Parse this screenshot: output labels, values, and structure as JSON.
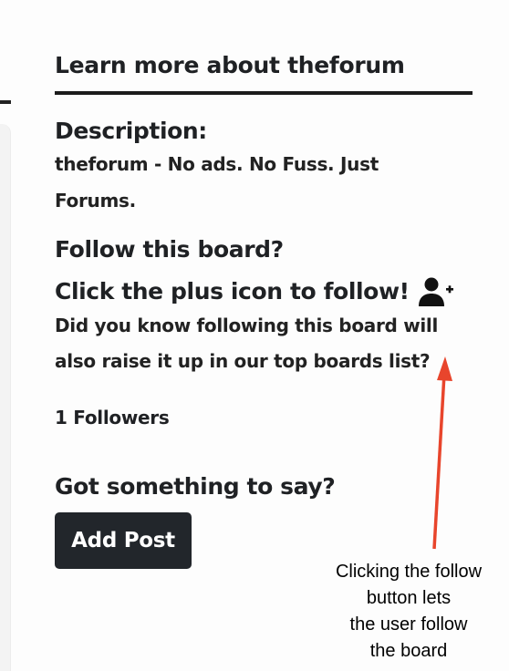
{
  "sidebar": {
    "title": "Learn more about theforum",
    "description": {
      "heading": "Description:",
      "text": "theforum - No ads. No Fuss. Just Forums."
    },
    "follow": {
      "heading": "Follow this board?",
      "prompt": "Click the plus icon to follow!",
      "icon": "user-plus-icon",
      "info": "Did you know following this board will also raise it up in our top boards list?"
    },
    "followers": "1 Followers",
    "post": {
      "heading": "Got something to say?",
      "button_label": "Add Post"
    }
  },
  "annotation": {
    "text": "Clicking the follow\nbutton lets\nthe user follow\nthe board",
    "arrow_color": "#e8452c"
  },
  "colors": {
    "button_bg": "#22262b",
    "text": "#1f2124"
  }
}
